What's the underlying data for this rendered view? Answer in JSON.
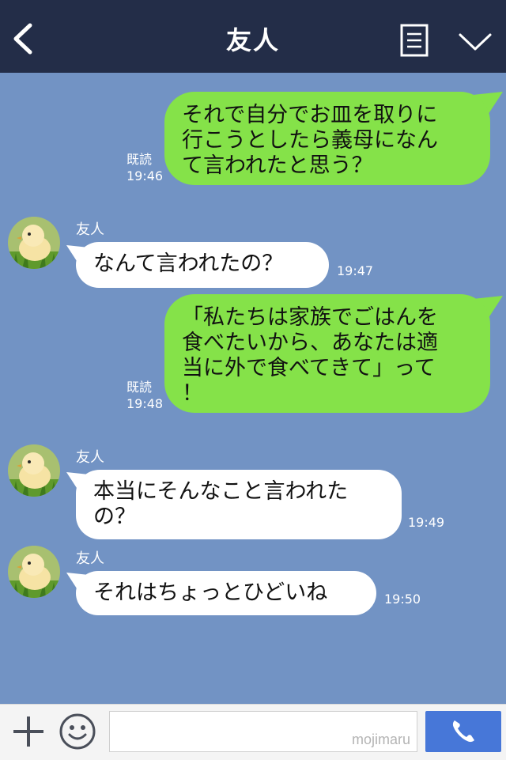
{
  "header": {
    "title": "友人"
  },
  "messages": [
    {
      "type": "out",
      "lines": [
        "それで自分でお皿を取りに",
        "行こうとしたら義母になん",
        "て言われたと思う？"
      ],
      "read": "既読",
      "time": "19:46"
    },
    {
      "type": "in",
      "sender": "友人",
      "lines": [
        "なんて言われたの？"
      ],
      "time": "19:47"
    },
    {
      "type": "out",
      "lines": [
        "「私たちは家族でごはんを",
        "食べたいから、あなたは適",
        "当に外で食べてきて」って",
        "！"
      ],
      "read": "既読",
      "time": "19:48"
    },
    {
      "type": "in",
      "sender": "友人",
      "lines": [
        "本当にそんなこと言われた",
        "の？"
      ],
      "time": "19:49"
    },
    {
      "type": "in",
      "sender": "友人",
      "lines": [
        "それはちょっとひどいね"
      ],
      "time": "19:50"
    }
  ],
  "input": {
    "watermark": "mojimaru"
  },
  "colors": {
    "header_bg": "#232d48",
    "chat_bg": "#7293c4",
    "out_bubble": "#85e249",
    "in_bubble": "#ffffff",
    "call_button": "#4777d8"
  },
  "icons": {
    "back": "chevron-left-icon",
    "menu": "list-icon",
    "collapse": "chevron-down-icon",
    "plus": "plus-icon",
    "emoji": "smiley-icon",
    "call": "phone-icon"
  }
}
